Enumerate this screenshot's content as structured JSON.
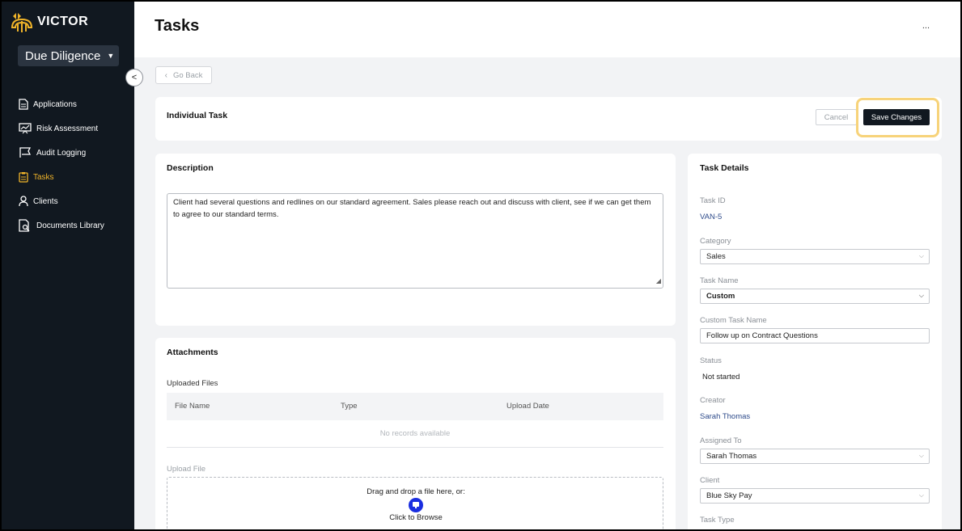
{
  "app": {
    "logo_text": "VICTOR",
    "module": "Due Diligence"
  },
  "sidebar": {
    "items": [
      {
        "label": "Applications",
        "icon": "document-icon",
        "active": false
      },
      {
        "label": "Risk Assessment",
        "icon": "chart-board-icon",
        "active": false
      },
      {
        "label": "Audit Logging",
        "icon": "flag-icon",
        "active": false
      },
      {
        "label": "Tasks",
        "icon": "clipboard-icon",
        "active": true
      },
      {
        "label": "Clients",
        "icon": "user-icon",
        "active": false
      },
      {
        "label": "Documents Library",
        "icon": "document-search-icon",
        "active": false
      }
    ]
  },
  "header": {
    "title": "Tasks",
    "more": "..."
  },
  "go_back": "Go Back",
  "task_header": {
    "title": "Individual Task",
    "cancel": "Cancel",
    "save": "Save Changes"
  },
  "description": {
    "title": "Description",
    "text": "Client had several questions and redlines on our standard agreement. Sales please reach out and discuss with client, see if we can get them to agree to our standard terms."
  },
  "attachments": {
    "title": "Attachments",
    "uploaded_files": "Uploaded Files",
    "columns": [
      "File Name",
      "Type",
      "Upload Date"
    ],
    "empty": "No records available",
    "upload_file": "Upload File",
    "drop_text": "Drag and drop a file here, or:",
    "browse": "Click to Browse"
  },
  "task_details": {
    "title": "Task Details",
    "task_id_label": "Task ID",
    "task_id": "VAN-5",
    "category_label": "Category",
    "category": "Sales",
    "task_name_label": "Task Name",
    "task_name": "Custom",
    "custom_task_name_label": "Custom Task Name",
    "custom_task_name": "Follow up on Contract Questions",
    "status_label": "Status",
    "status": "Not started",
    "creator_label": "Creator",
    "creator": "Sarah Thomas",
    "assigned_to_label": "Assigned To",
    "assigned_to": "Sarah Thomas",
    "client_label": "Client",
    "client": "Blue Sky Pay",
    "task_type_label": "Task Type"
  },
  "colors": {
    "sidebar_bg": "#111820",
    "accent": "#f0b429",
    "highlight": "#f7d37a",
    "primary_button": "#111820",
    "link_blue": "#2d4a8a"
  }
}
